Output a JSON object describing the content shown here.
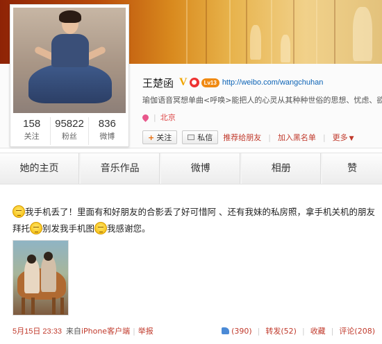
{
  "profile": {
    "name": "王楚函",
    "verified_icon": "V",
    "badge_icon": "weibo-badge-icon",
    "level_badge": "Lv13",
    "url": "http://weibo.com/wangchuhan",
    "intro": "瑜伽语音冥想单曲<呼唤>能把人的心灵从其种种世俗的思想、忧虑、欲望中解脱出来",
    "location": "北京",
    "stats": [
      {
        "value": "158",
        "label": "关注"
      },
      {
        "value": "95822",
        "label": "粉丝"
      },
      {
        "value": "836",
        "label": "微博"
      }
    ]
  },
  "actions": {
    "follow": "关注",
    "message": "私信",
    "recommend": "推荐给朋友",
    "blacklist": "加入黑名单",
    "more": "更多"
  },
  "tabs": [
    {
      "label": "她的主页"
    },
    {
      "label": "音乐作品"
    },
    {
      "label": "微博"
    },
    {
      "label": "相册"
    },
    {
      "label": "赞"
    }
  ],
  "post": {
    "text_part1": "我手机丢了！里面有和好朋友的合影丢了好可惜阿 、还有我妹的私房照，拿手机关机的朋友拜托",
    "text_part2": "别发我手机图",
    "text_part3": "我感谢您。",
    "time": "5月15日 23:33",
    "from_label": "来自",
    "source": "iPhone客户端",
    "report": "举报",
    "like": "(390)",
    "repost": "转发(52)",
    "favorite": "收藏",
    "comment": "评论(208)"
  },
  "colors": {
    "link_red": "#c0392b",
    "link_blue": "#0a62b5",
    "accent_orange": "#e86d0c"
  }
}
